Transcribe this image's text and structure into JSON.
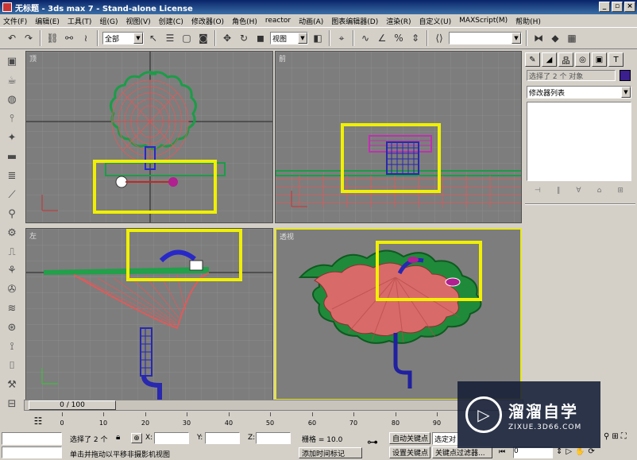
{
  "window": {
    "title": "无标题 - 3ds max 7 - Stand-alone License",
    "min": "_",
    "max": "▫",
    "close": "×"
  },
  "menu": [
    "文件(F)",
    "编辑(E)",
    "工具(T)",
    "组(G)",
    "视图(V)",
    "创建(C)",
    "修改器(O)",
    "角色(H)",
    "reactor",
    "动画(A)",
    "图表编辑器(D)",
    "渲染(R)",
    "自定义(U)",
    "MAXScript(M)",
    "帮助(H)"
  ],
  "toolbar": {
    "selection_filter": "全部",
    "ref_coord": "视图",
    "named_selection": ""
  },
  "viewports": {
    "top": "顶",
    "front": "前",
    "left": "左",
    "perspective": "透视"
  },
  "command_panel": {
    "selection_info": "选择了 2 个 对象",
    "modifier_list": "修改器列表",
    "color": "#3b1f8f"
  },
  "timeline": {
    "slider": "0 / 100",
    "ticks": [
      "0",
      "10",
      "20",
      "30",
      "40",
      "50",
      "60",
      "70",
      "80",
      "90"
    ]
  },
  "status": {
    "selected": "选择了 2 个",
    "x_label": "X:",
    "y_label": "Y:",
    "z_label": "Z:",
    "x_value": "",
    "y_value": "",
    "z_value": "",
    "grid": "栅格 = 10.0",
    "prompt": "单击并拖动以平移非摄影机视图",
    "add_time_tag": "添加时间标记",
    "auto_key": "自动关键点",
    "set_key": "设置关键点",
    "selected_obj": "选定对",
    "key_filters": "关键点过滤器...",
    "frame": "0"
  },
  "watermark": {
    "title": "溜溜自学",
    "url": "ZIXUE.3D66.COM"
  }
}
